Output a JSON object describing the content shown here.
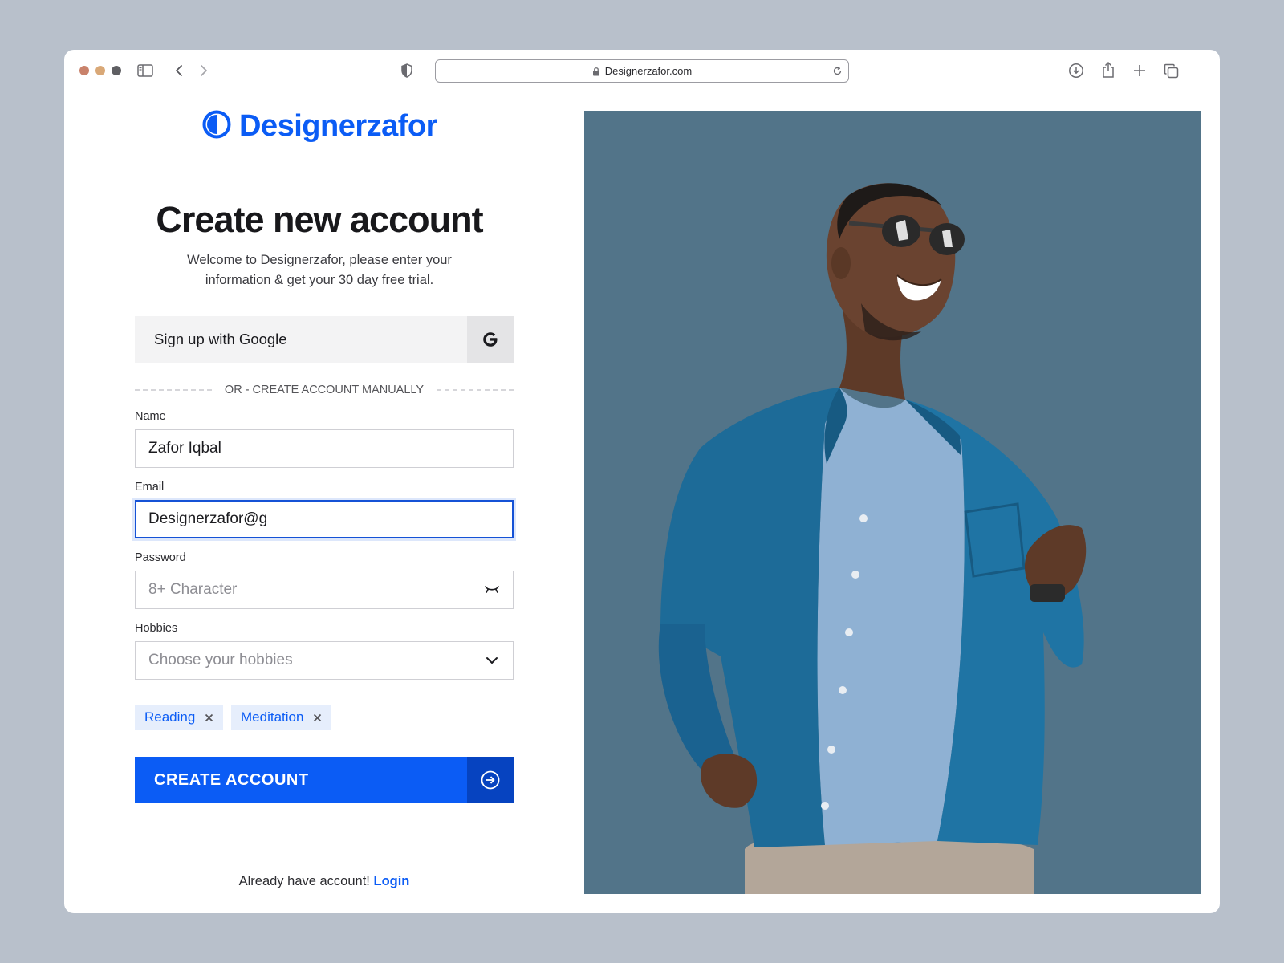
{
  "browser": {
    "url": "Designerzafor.com",
    "traffic_colors": [
      "#c9826b",
      "#d9a877",
      "#5f5f63"
    ]
  },
  "brand": {
    "name": "Designerzafor",
    "accent": "#0b5cf5"
  },
  "form": {
    "title": "Create new account",
    "subtitle": "Welcome to Designerzafor, please enter your information & get your 30 day free trial.",
    "google_label": "Sign up with Google",
    "divider_text": "OR - CREATE ACCOUNT MANUALLY",
    "name": {
      "label": "Name",
      "value": "Zafor Iqbal"
    },
    "email": {
      "label": "Email",
      "value": "Designerzafor@g"
    },
    "password": {
      "label": "Password",
      "placeholder": "8+ Character"
    },
    "hobbies": {
      "label": "Hobbies",
      "placeholder": "Choose your hobbies",
      "chips": [
        "Reading",
        "Meditation"
      ]
    },
    "submit_label": "CREATE ACCOUNT",
    "login_prompt": "Already have account!",
    "login_link": "Login"
  },
  "icons": {
    "google": "google-g-icon",
    "password_toggle": "eye-closed-icon",
    "hobbies_dropdown": "chevron-down-icon",
    "chip_remove": "close-icon",
    "submit": "arrow-right-circle-icon"
  },
  "hero": {
    "background": "#527489",
    "subject": "photo"
  }
}
